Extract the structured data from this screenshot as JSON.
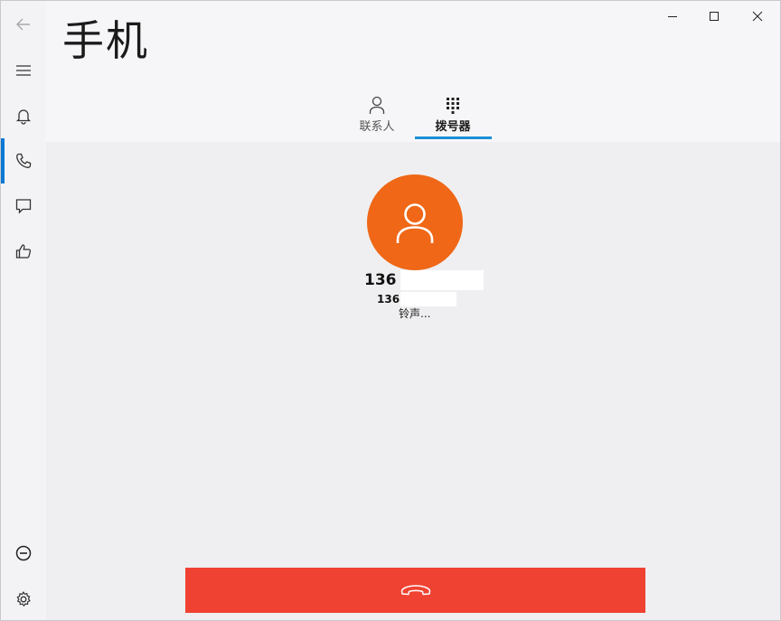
{
  "app": {
    "title": "手机"
  },
  "tabs": [
    {
      "label": "联系人",
      "icon": "person-icon",
      "active": false
    },
    {
      "label": "拨号器",
      "icon": "dialpad-icon",
      "active": true
    }
  ],
  "rail": {
    "items": [
      {
        "name": "back",
        "icon": "back-arrow-icon"
      },
      {
        "name": "menu",
        "icon": "hamburger-icon"
      },
      {
        "name": "notifications",
        "icon": "bell-icon"
      },
      {
        "name": "calls",
        "icon": "phone-icon",
        "active": true
      },
      {
        "name": "messages",
        "icon": "chat-icon"
      },
      {
        "name": "feedback",
        "icon": "thumbs-up-icon"
      },
      {
        "name": "disconnect",
        "icon": "minus-circle-icon"
      },
      {
        "name": "settings",
        "icon": "gear-icon"
      }
    ]
  },
  "call": {
    "number": "136",
    "sub_number": "136",
    "status": "铃声..."
  },
  "colors": {
    "accent": "#0a78d4",
    "avatar": "#ef6717",
    "hangup": "#ef4232"
  }
}
